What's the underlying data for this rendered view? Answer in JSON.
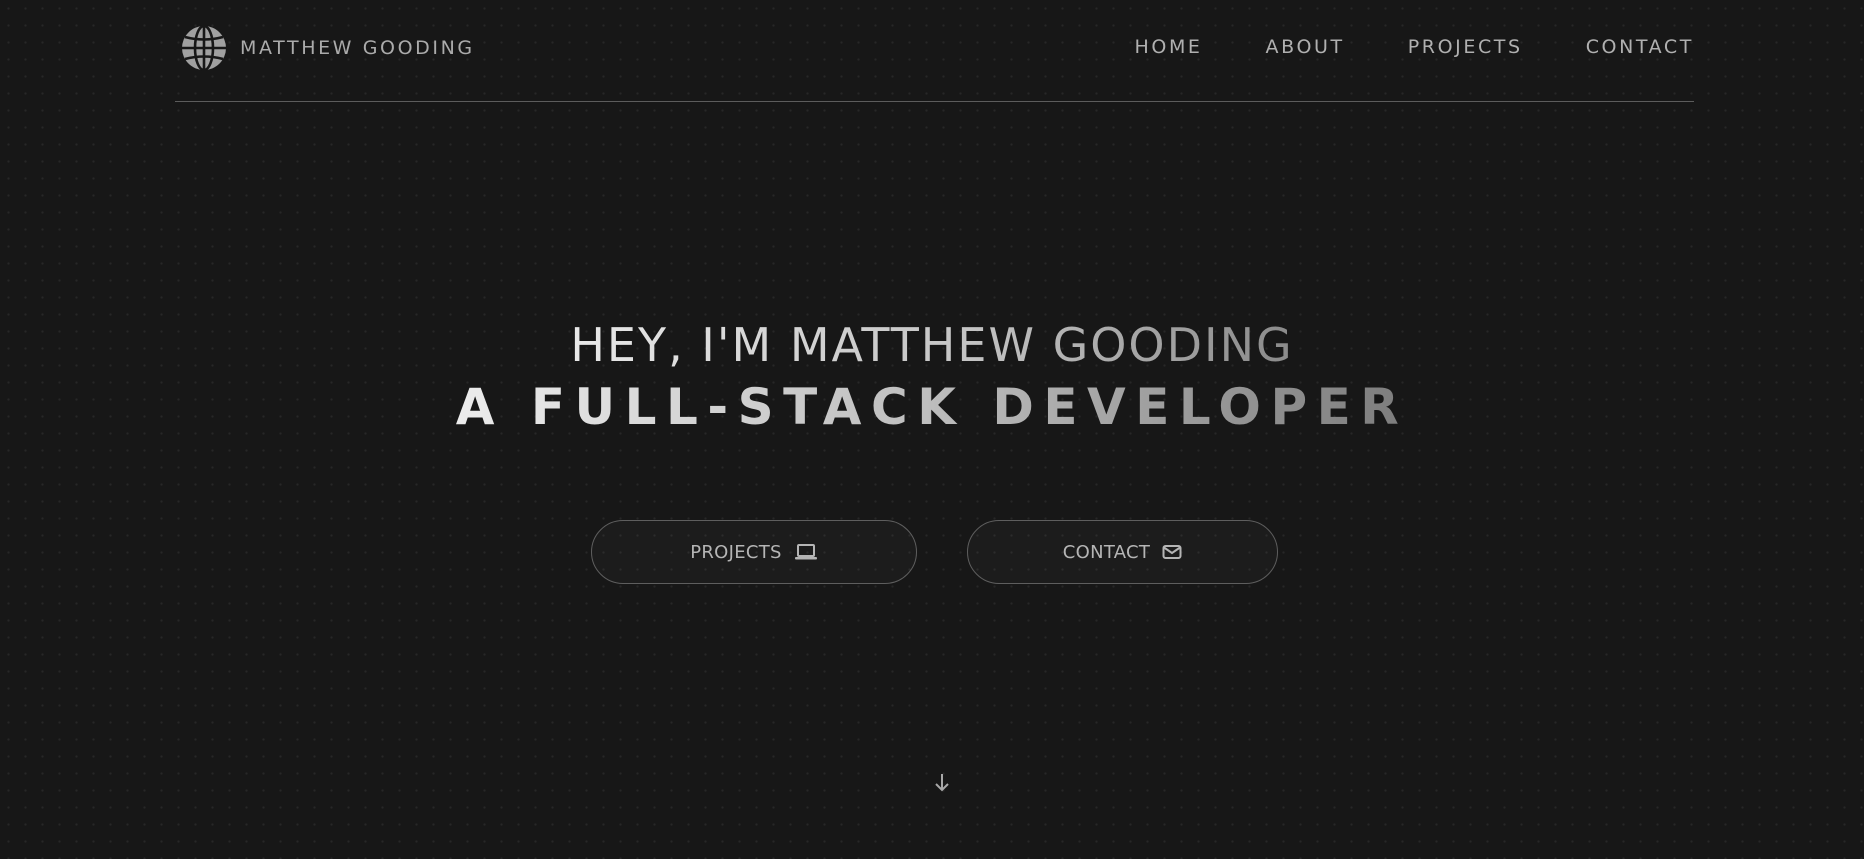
{
  "header": {
    "brand_name": "MATTHEW GOODING",
    "logo_icon": "globe-icon",
    "nav": {
      "home": "HOME",
      "about": "ABOUT",
      "projects": "PROJECTS",
      "contact": "CONTACT"
    }
  },
  "hero": {
    "line1": "HEY, I'M MATTHEW GOODING",
    "line2": "A FULL-STACK DEVELOPER"
  },
  "cta": {
    "projects_label": "PROJECTS",
    "projects_icon": "laptop-icon",
    "contact_label": "CONTACT",
    "contact_icon": "mail-icon"
  },
  "scroll": {
    "icon": "arrow-down-icon"
  },
  "colors": {
    "background": "#171717",
    "text": "#b0b0b0",
    "divider": "#5c5c5c"
  }
}
